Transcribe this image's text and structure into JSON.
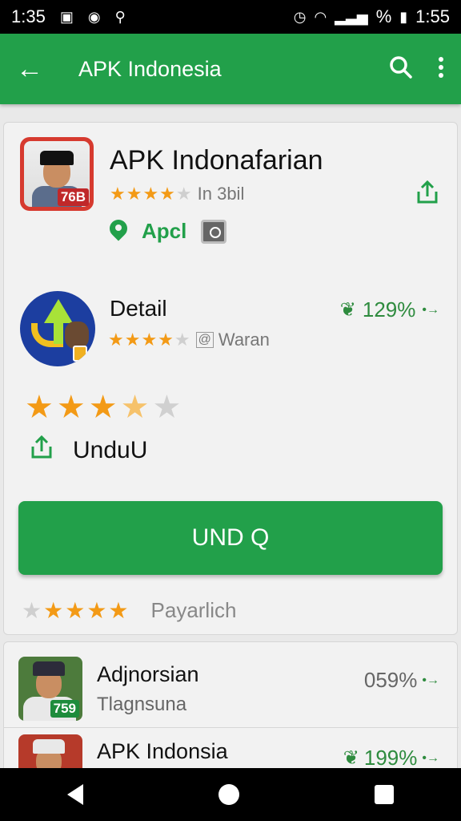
{
  "status_bar": {
    "time_left": "1:35",
    "time_right": "1:55",
    "signal_text": "%"
  },
  "app_bar": {
    "title": "APK Indonesia",
    "back_icon": "arrow-left-icon",
    "search_icon": "search-icon",
    "menu_icon": "more-vert-icon"
  },
  "app_card": {
    "title": "APK Indonafarian",
    "icon_badge": "76B",
    "rating_text": "In 3bil",
    "location_label": "Apcl",
    "detail": {
      "title": "Detail",
      "percent": "129",
      "percent_suffix": "%",
      "rating_text": "Waran",
      "rating_icon": "@"
    },
    "big_rating": 3.5,
    "unduh_label": "UnduU",
    "install_label": "UND Q",
    "review_label": "Payarlich"
  },
  "list": [
    {
      "title": "Adjnorsian",
      "subtitle": "Tlagnsuna",
      "badge": "759",
      "percent": "059",
      "percent_suffix": "%"
    },
    {
      "title": "APK Indonsia",
      "percent": "199",
      "percent_suffix": "%"
    }
  ],
  "colors": {
    "primary": "#22a04a",
    "star": "#f39a16",
    "status_bar": "#000000"
  }
}
